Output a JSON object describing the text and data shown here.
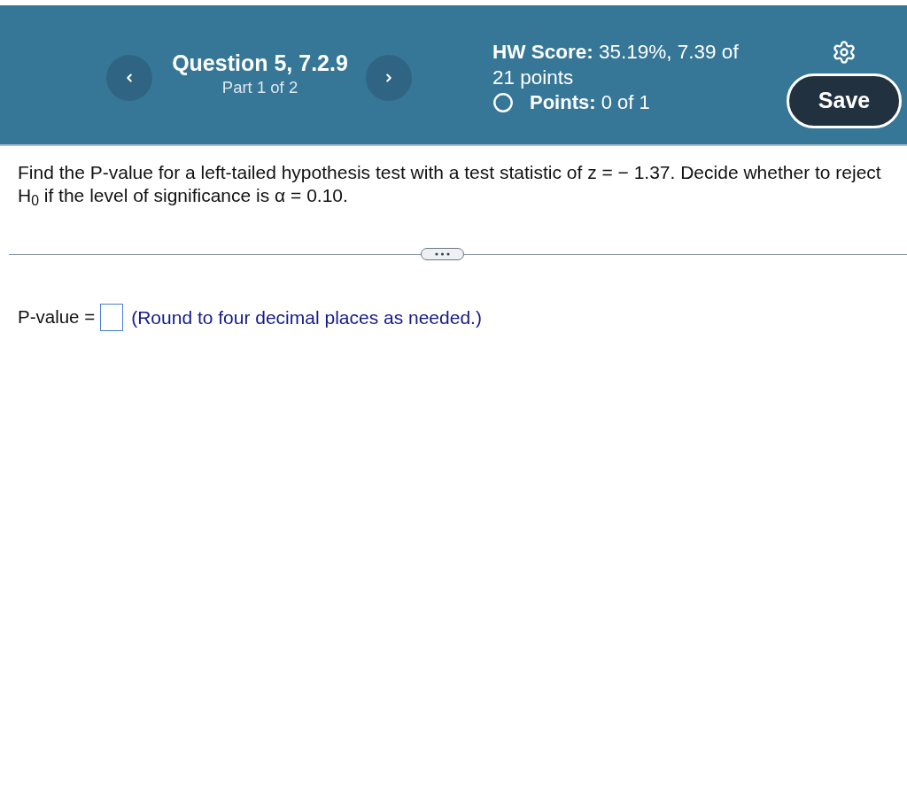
{
  "header": {
    "question_title": "Question 5, 7.2.9",
    "part": "Part 1 of 2",
    "hw_score": "**HW Score:** 35.19%, 7.39 of 21 points",
    "points": "**Points:** 0 of 1",
    "save_button": "Save"
  },
  "question": {
    "text": "Find the P-value for a left-tailed hypothesis test with a test statistic of z =  − 1.37. Decide whether to reject H$_{0}$ if the level of significance is α = 0.10."
  },
  "answer": {
    "label": "P-value =",
    "hint": "(Round to four decimal places as needed.)"
  }
}
